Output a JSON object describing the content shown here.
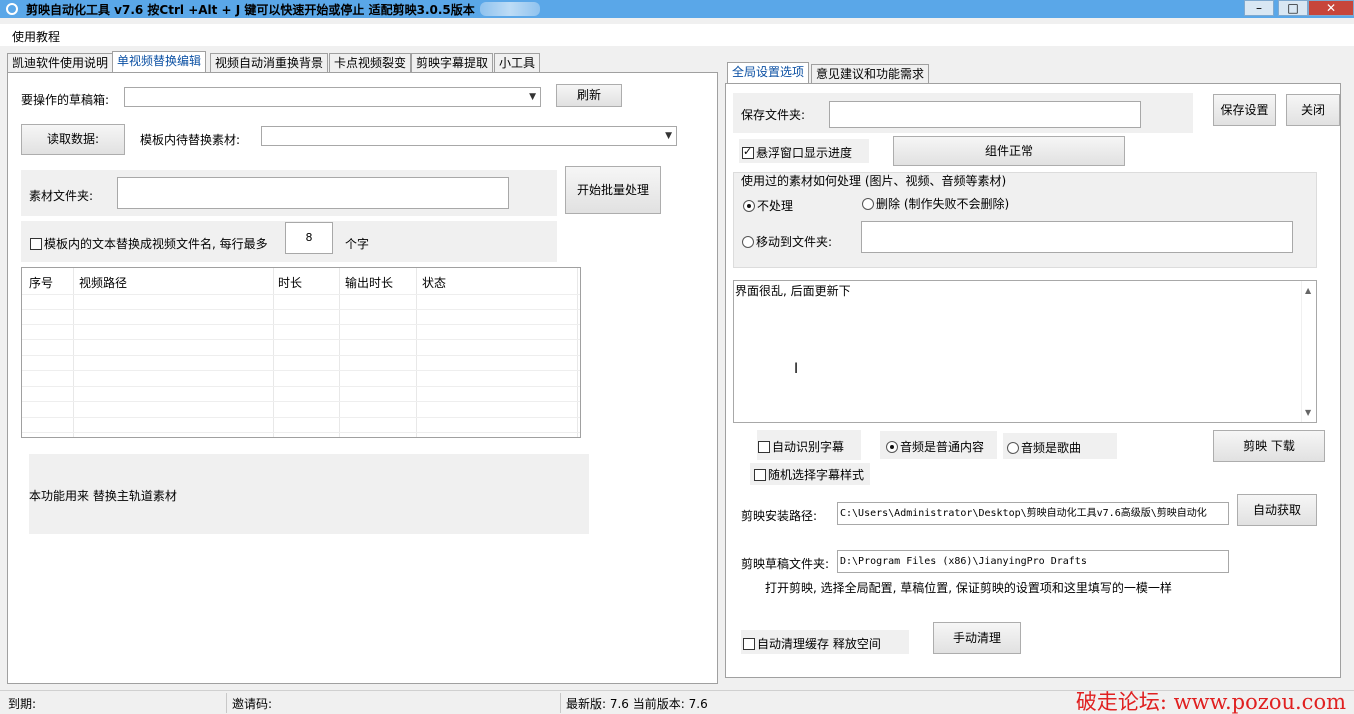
{
  "window": {
    "title": "剪映自动化工具 v7.6    按Ctrl +Alt + J 键可以快速开始或停止    适配剪映3.0.5版本",
    "minimize": "–",
    "maximize": "□",
    "close": "✕"
  },
  "menu": {
    "tutorial": "使用教程"
  },
  "left_tabs": [
    {
      "label": "凯迪软件使用说明"
    },
    {
      "label": "单视频替换编辑"
    },
    {
      "label": "视频自动消重换背景"
    },
    {
      "label": "卡点视频裂变"
    },
    {
      "label": "剪映字幕提取"
    },
    {
      "label": "小工具"
    }
  ],
  "left": {
    "draft_label": "要操作的草稿箱:",
    "refresh": "刷新",
    "read_data": "读取数据:",
    "template_label": "模板内待替换素材:",
    "material_folder_label": "素材文件夹:",
    "start_batch": "开始批量处理",
    "replace_text_label": "模板内的文本替换成视频文件名, 每行最多",
    "max_chars": "8",
    "chars_unit": "个字",
    "table_headers": [
      "序号",
      "视频路径",
      "时长",
      "输出时长",
      "状态"
    ],
    "description": "本功能用来 替换主轨道素材"
  },
  "right_tabs": [
    {
      "label": "全局设置选项"
    },
    {
      "label": "意见建议和功能需求"
    }
  ],
  "right": {
    "save_folder_label": "保存文件夹:",
    "save_settings": "保存设置",
    "close": "关闭",
    "floating_progress": "悬浮窗口显示进度",
    "component_ok": "组件正常",
    "used_material_group": "使用过的素材如何处理 (图片、视频、音频等素材)",
    "no_process": "不处理",
    "delete": "删除 (制作失败不会删除)",
    "move_to_folder": "移动到文件夹:",
    "notes": "界面很乱, 后面更新下",
    "auto_subtitle": "自动识别字幕",
    "audio_normal": "音频是普通内容",
    "audio_song": "音频是歌曲",
    "jianying_download": "剪映 下载",
    "random_subtitle_style": "随机选择字幕样式",
    "install_path_label": "剪映安装路径:",
    "install_path_value": "C:\\Users\\Administrator\\Desktop\\剪映自动化工具v7.6高级版\\剪映自动化",
    "auto_get": "自动获取",
    "draft_folder_label": "剪映草稿文件夹:",
    "draft_folder_value": "D:\\Program Files (x86)\\JianyingPro Drafts",
    "hint": "打开剪映, 选择全局配置, 草稿位置, 保证剪映的设置项和这里填写的一模一样",
    "auto_clear_cache": "自动清理缓存 释放空间",
    "manual_clear": "手动清理"
  },
  "status": {
    "expire": "到期:",
    "invite": "邀请码:",
    "version": "最新版: 7.6 当前版本: 7.6"
  },
  "watermark": "破走论坛: www.pozou.com"
}
